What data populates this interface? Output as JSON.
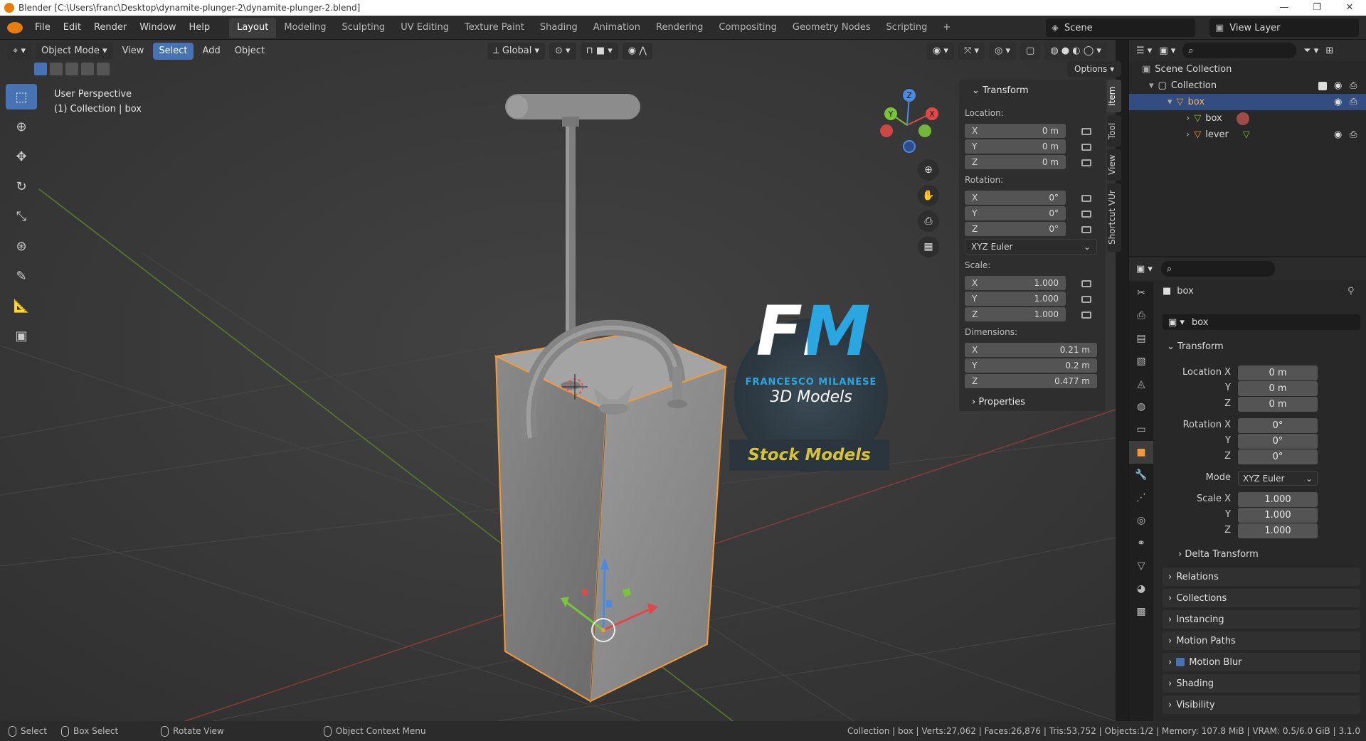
{
  "title": {
    "text": "Blender [C:\\Users\\franc\\Desktop\\dynamite-plunger-2\\dynamite-plunger-2.blend]"
  },
  "window_controls": {
    "minimize": "—",
    "maximize": "❐",
    "close": "✕"
  },
  "menu": {
    "file": "File",
    "edit": "Edit",
    "render": "Render",
    "window": "Window",
    "help": "Help"
  },
  "workspaces": [
    "Layout",
    "Modeling",
    "Sculpting",
    "UV Editing",
    "Texture Paint",
    "Shading",
    "Animation",
    "Rendering",
    "Compositing",
    "Geometry Nodes",
    "Scripting",
    "+"
  ],
  "scene": {
    "name": "Scene"
  },
  "view_layer": {
    "name": "View Layer"
  },
  "viewport_header": {
    "mode": "Object Mode",
    "view": "View",
    "select": "Select",
    "add": "Add",
    "object": "Object",
    "orientation": "Global",
    "options": "Options"
  },
  "viewport_overlay": {
    "line1": "User Perspective",
    "line2": "(1) Collection | box"
  },
  "gizmo_axes": {
    "x": "X",
    "y": "Y",
    "z": "Z"
  },
  "watermark": {
    "fm": "FM",
    "name": "FRANCESCO MILANESE",
    "sub": "3D Models",
    "stock": "Stock Models"
  },
  "npanel": {
    "transform_header": "Transform",
    "location_label": "Location:",
    "location": {
      "x": "0 m",
      "y": "0 m",
      "z": "0 m"
    },
    "rotation_label": "Rotation:",
    "rotation": {
      "x": "0°",
      "y": "0°",
      "z": "0°"
    },
    "rotation_mode": "XYZ Euler",
    "scale_label": "Scale:",
    "scale": {
      "x": "1.000",
      "y": "1.000",
      "z": "1.000"
    },
    "dimensions_label": "Dimensions:",
    "dimensions": {
      "x": "0.21 m",
      "y": "0.2 m",
      "z": "0.477 m"
    },
    "properties_header": "Properties",
    "axis_x": "X",
    "axis_y": "Y",
    "axis_z": "Z"
  },
  "npanel_tabs": [
    "Item",
    "Tool",
    "View",
    "Shortcut VUr"
  ],
  "outliner": {
    "scene_collection": "Scene Collection",
    "collection": "Collection",
    "box": "box",
    "box_mesh": "box",
    "lever": "lever"
  },
  "properties": {
    "object_name": "box",
    "object_field": "box",
    "transform_header": "Transform",
    "location_x_label": "Location X",
    "location": {
      "x": "0 m",
      "y": "0 m",
      "z": "0 m"
    },
    "rotation_x_label": "Rotation X",
    "rotation": {
      "x": "0°",
      "y": "0°",
      "z": "0°"
    },
    "mode_label": "Mode",
    "mode_value": "XYZ Euler",
    "scale_x_label": "Scale X",
    "scale": {
      "x": "1.000",
      "y": "1.000",
      "z": "1.000"
    },
    "y_label": "Y",
    "z_label": "Z",
    "sections": [
      "Delta Transform",
      "Relations",
      "Collections",
      "Instancing",
      "Motion Paths",
      "Motion Blur",
      "Shading",
      "Visibility"
    ]
  },
  "status": {
    "select": "Select",
    "box_select": "Box Select",
    "rotate_view": "Rotate View",
    "context_menu": "Object Context Menu",
    "stats": "Collection | box | Verts:27,062 | Faces:26,876 | Tris:53,752 | Objects:1/2 | Memory: 107.8 MiB | VRAM: 0.5/6.0 GiB | 3.1.0"
  },
  "colors": {
    "accent": "#4772b3",
    "selection_orange": "#f29a3a",
    "viewport_bg": "#3c3c3c"
  }
}
